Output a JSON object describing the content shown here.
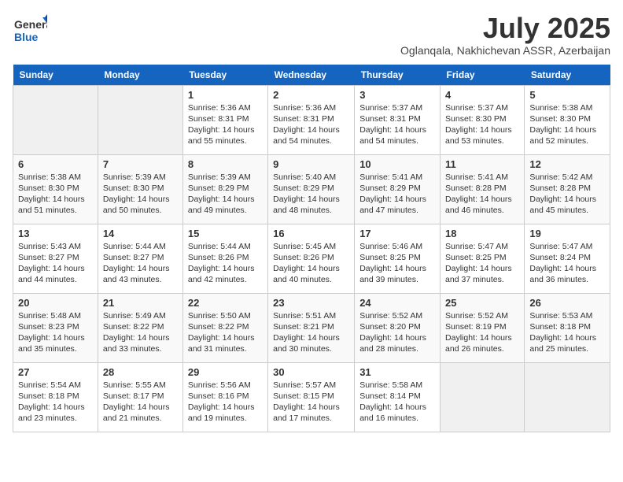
{
  "header": {
    "logo_general": "General",
    "logo_blue": "Blue",
    "month_title": "July 2025",
    "location": "Oglanqala, Nakhichevan ASSR, Azerbaijan"
  },
  "days_of_week": [
    "Sunday",
    "Monday",
    "Tuesday",
    "Wednesday",
    "Thursday",
    "Friday",
    "Saturday"
  ],
  "weeks": [
    [
      null,
      null,
      {
        "day": 1,
        "sunrise": "5:36 AM",
        "sunset": "8:31 PM",
        "daylight": "14 hours and 55 minutes."
      },
      {
        "day": 2,
        "sunrise": "5:36 AM",
        "sunset": "8:31 PM",
        "daylight": "14 hours and 54 minutes."
      },
      {
        "day": 3,
        "sunrise": "5:37 AM",
        "sunset": "8:31 PM",
        "daylight": "14 hours and 54 minutes."
      },
      {
        "day": 4,
        "sunrise": "5:37 AM",
        "sunset": "8:30 PM",
        "daylight": "14 hours and 53 minutes."
      },
      {
        "day": 5,
        "sunrise": "5:38 AM",
        "sunset": "8:30 PM",
        "daylight": "14 hours and 52 minutes."
      }
    ],
    [
      {
        "day": 6,
        "sunrise": "5:38 AM",
        "sunset": "8:30 PM",
        "daylight": "14 hours and 51 minutes."
      },
      {
        "day": 7,
        "sunrise": "5:39 AM",
        "sunset": "8:30 PM",
        "daylight": "14 hours and 50 minutes."
      },
      {
        "day": 8,
        "sunrise": "5:39 AM",
        "sunset": "8:29 PM",
        "daylight": "14 hours and 49 minutes."
      },
      {
        "day": 9,
        "sunrise": "5:40 AM",
        "sunset": "8:29 PM",
        "daylight": "14 hours and 48 minutes."
      },
      {
        "day": 10,
        "sunrise": "5:41 AM",
        "sunset": "8:29 PM",
        "daylight": "14 hours and 47 minutes."
      },
      {
        "day": 11,
        "sunrise": "5:41 AM",
        "sunset": "8:28 PM",
        "daylight": "14 hours and 46 minutes."
      },
      {
        "day": 12,
        "sunrise": "5:42 AM",
        "sunset": "8:28 PM",
        "daylight": "14 hours and 45 minutes."
      }
    ],
    [
      {
        "day": 13,
        "sunrise": "5:43 AM",
        "sunset": "8:27 PM",
        "daylight": "14 hours and 44 minutes."
      },
      {
        "day": 14,
        "sunrise": "5:44 AM",
        "sunset": "8:27 PM",
        "daylight": "14 hours and 43 minutes."
      },
      {
        "day": 15,
        "sunrise": "5:44 AM",
        "sunset": "8:26 PM",
        "daylight": "14 hours and 42 minutes."
      },
      {
        "day": 16,
        "sunrise": "5:45 AM",
        "sunset": "8:26 PM",
        "daylight": "14 hours and 40 minutes."
      },
      {
        "day": 17,
        "sunrise": "5:46 AM",
        "sunset": "8:25 PM",
        "daylight": "14 hours and 39 minutes."
      },
      {
        "day": 18,
        "sunrise": "5:47 AM",
        "sunset": "8:25 PM",
        "daylight": "14 hours and 37 minutes."
      },
      {
        "day": 19,
        "sunrise": "5:47 AM",
        "sunset": "8:24 PM",
        "daylight": "14 hours and 36 minutes."
      }
    ],
    [
      {
        "day": 20,
        "sunrise": "5:48 AM",
        "sunset": "8:23 PM",
        "daylight": "14 hours and 35 minutes."
      },
      {
        "day": 21,
        "sunrise": "5:49 AM",
        "sunset": "8:22 PM",
        "daylight": "14 hours and 33 minutes."
      },
      {
        "day": 22,
        "sunrise": "5:50 AM",
        "sunset": "8:22 PM",
        "daylight": "14 hours and 31 minutes."
      },
      {
        "day": 23,
        "sunrise": "5:51 AM",
        "sunset": "8:21 PM",
        "daylight": "14 hours and 30 minutes."
      },
      {
        "day": 24,
        "sunrise": "5:52 AM",
        "sunset": "8:20 PM",
        "daylight": "14 hours and 28 minutes."
      },
      {
        "day": 25,
        "sunrise": "5:52 AM",
        "sunset": "8:19 PM",
        "daylight": "14 hours and 26 minutes."
      },
      {
        "day": 26,
        "sunrise": "5:53 AM",
        "sunset": "8:18 PM",
        "daylight": "14 hours and 25 minutes."
      }
    ],
    [
      {
        "day": 27,
        "sunrise": "5:54 AM",
        "sunset": "8:18 PM",
        "daylight": "14 hours and 23 minutes."
      },
      {
        "day": 28,
        "sunrise": "5:55 AM",
        "sunset": "8:17 PM",
        "daylight": "14 hours and 21 minutes."
      },
      {
        "day": 29,
        "sunrise": "5:56 AM",
        "sunset": "8:16 PM",
        "daylight": "14 hours and 19 minutes."
      },
      {
        "day": 30,
        "sunrise": "5:57 AM",
        "sunset": "8:15 PM",
        "daylight": "14 hours and 17 minutes."
      },
      {
        "day": 31,
        "sunrise": "5:58 AM",
        "sunset": "8:14 PM",
        "daylight": "14 hours and 16 minutes."
      },
      null,
      null
    ]
  ]
}
